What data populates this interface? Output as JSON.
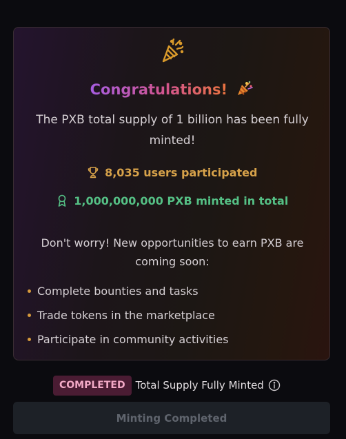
{
  "card": {
    "header_icon": "party-popper-icon",
    "title": "Congratulations!",
    "title_emoji_icon": "party-popper-emoji-icon",
    "supply_message": "The PXB total supply of 1 billion has been fully minted!",
    "stats": [
      {
        "icon": "trophy-icon",
        "text": "8,035 users participated",
        "color": "#d7a24a"
      },
      {
        "icon": "award-ribbon-icon",
        "text": "1,000,000,000 PXB minted in total",
        "color": "#55c085"
      }
    ],
    "opportunities_message": "Don't worry! New opportunities to earn PXB are coming soon:",
    "opportunities": [
      "Complete bounties and tasks",
      "Trade tokens in the marketplace",
      "Participate in community activities"
    ]
  },
  "status": {
    "badge": "COMPLETED",
    "label": "Total Supply Fully Minted",
    "info_icon": "info-icon"
  },
  "mint_button": {
    "label": "Minting Completed",
    "disabled": true
  },
  "colors": {
    "page_background": "#0b0b0f",
    "accent_gold": "#d7a24a",
    "accent_green": "#55c085",
    "badge_background": "#4a1c33",
    "badge_text": "#f2a9c6"
  }
}
